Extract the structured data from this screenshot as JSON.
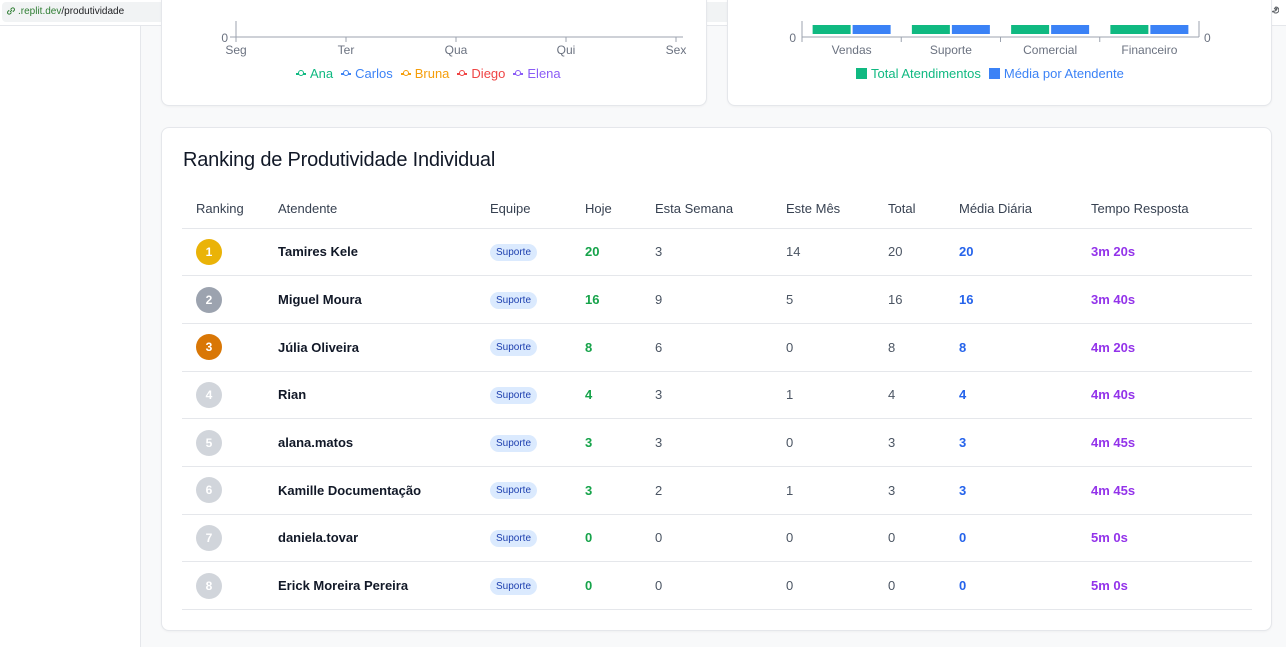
{
  "browser": {
    "url_domain": ".replit.dev",
    "url_path": "/produtividade"
  },
  "line_chart": {
    "chart_data": {
      "type": "line",
      "categories": [
        "Seg",
        "Ter",
        "Qua",
        "Qui",
        "Sex"
      ],
      "y_tick_visible": "0",
      "series": [
        {
          "name": "Ana",
          "color": "#10b981"
        },
        {
          "name": "Carlos",
          "color": "#3b82f6"
        },
        {
          "name": "Bruna",
          "color": "#f59e0b"
        },
        {
          "name": "Diego",
          "color": "#ef4444"
        },
        {
          "name": "Elena",
          "color": "#8b5cf6"
        }
      ]
    }
  },
  "bar_chart": {
    "chart_data": {
      "type": "bar",
      "categories": [
        "Vendas",
        "Suporte",
        "Comercial",
        "Financeiro"
      ],
      "y_left_tick_visible": "0",
      "y_right_tick_visible": "0",
      "series": [
        {
          "name": "Total Atendimentos",
          "color": "#10b981"
        },
        {
          "name": "Média por Atendente",
          "color": "#3b82f6"
        }
      ]
    }
  },
  "ranking": {
    "title": "Ranking de Produtividade Individual",
    "columns": [
      "Ranking",
      "Atendente",
      "Equipe",
      "Hoje",
      "Esta Semana",
      "Este Mês",
      "Total",
      "Média Diária",
      "Tempo Resposta"
    ],
    "rows": [
      {
        "rank": "1",
        "rank_color": "#eab308",
        "name": "Tamires Kele",
        "team": "Suporte",
        "today": "20",
        "week": "3",
        "month": "14",
        "total": "20",
        "avg": "20",
        "response": "3m 20s"
      },
      {
        "rank": "2",
        "rank_color": "#9ca3af",
        "name": "Miguel Moura",
        "team": "Suporte",
        "today": "16",
        "week": "9",
        "month": "5",
        "total": "16",
        "avg": "16",
        "response": "3m 40s"
      },
      {
        "rank": "3",
        "rank_color": "#d97706",
        "name": "Júlia Oliveira",
        "team": "Suporte",
        "today": "8",
        "week": "6",
        "month": "0",
        "total": "8",
        "avg": "8",
        "response": "4m 20s"
      },
      {
        "rank": "4",
        "rank_color": "#d1d5db",
        "name": "Rian",
        "team": "Suporte",
        "today": "4",
        "week": "3",
        "month": "1",
        "total": "4",
        "avg": "4",
        "response": "4m 40s"
      },
      {
        "rank": "5",
        "rank_color": "#d1d5db",
        "name": "alana.matos",
        "team": "Suporte",
        "today": "3",
        "week": "3",
        "month": "0",
        "total": "3",
        "avg": "3",
        "response": "4m 45s"
      },
      {
        "rank": "6",
        "rank_color": "#d1d5db",
        "name": "Kamille Documentação",
        "team": "Suporte",
        "today": "3",
        "week": "2",
        "month": "1",
        "total": "3",
        "avg": "3",
        "response": "4m 45s"
      },
      {
        "rank": "7",
        "rank_color": "#d1d5db",
        "name": "daniela.tovar",
        "team": "Suporte",
        "today": "0",
        "week": "0",
        "month": "0",
        "total": "0",
        "avg": "0",
        "response": "5m 0s"
      },
      {
        "rank": "8",
        "rank_color": "#d1d5db",
        "name": "Erick Moreira Pereira",
        "team": "Suporte",
        "today": "0",
        "week": "0",
        "month": "0",
        "total": "0",
        "avg": "0",
        "response": "5m 0s"
      }
    ]
  }
}
